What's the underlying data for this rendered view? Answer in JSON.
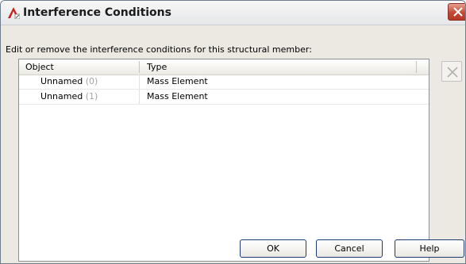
{
  "window": {
    "title": "Interference Conditions",
    "icon": "autocad-icon",
    "close_icon": "close-icon"
  },
  "instructions": "Edit or remove the interference conditions for this structural member:",
  "list": {
    "columns": [
      "Object",
      "Type"
    ],
    "rows": [
      {
        "name": "Unnamed",
        "index": "(0)",
        "type": "Mass Element"
      },
      {
        "name": "Unnamed",
        "index": "(1)",
        "type": "Mass Element"
      }
    ]
  },
  "delete_icon": "delete-x-icon",
  "buttons": {
    "ok": "OK",
    "cancel": "Cancel",
    "help": "Help"
  },
  "colors": {
    "close_button": "#c24a34",
    "dialog_background": "#ebe9e2",
    "index_gray": "#a5a5a5"
  }
}
